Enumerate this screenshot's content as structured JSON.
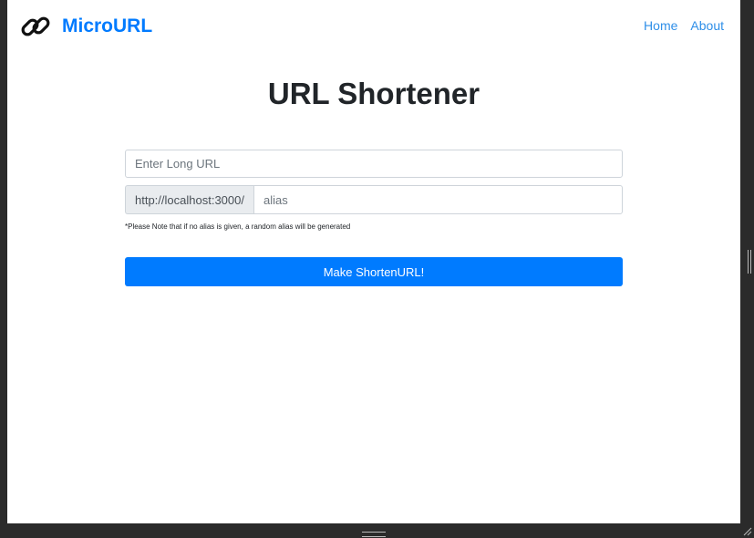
{
  "navbar": {
    "brand": "MicroURL",
    "brand_icon": "link-icon",
    "links": [
      {
        "label": "Home"
      },
      {
        "label": "About"
      }
    ]
  },
  "main": {
    "title": "URL Shortener",
    "long_url": {
      "placeholder": "Enter Long URL",
      "value": ""
    },
    "alias": {
      "prefix": "http://localhost:3000/",
      "placeholder": "alias",
      "value": ""
    },
    "note": "*Please Note that if no alias is given, a random alias will be generated",
    "submit_label": "Make ShortenURL!"
  },
  "colors": {
    "accent": "#007bff",
    "window_frame": "#2b2b2b"
  }
}
